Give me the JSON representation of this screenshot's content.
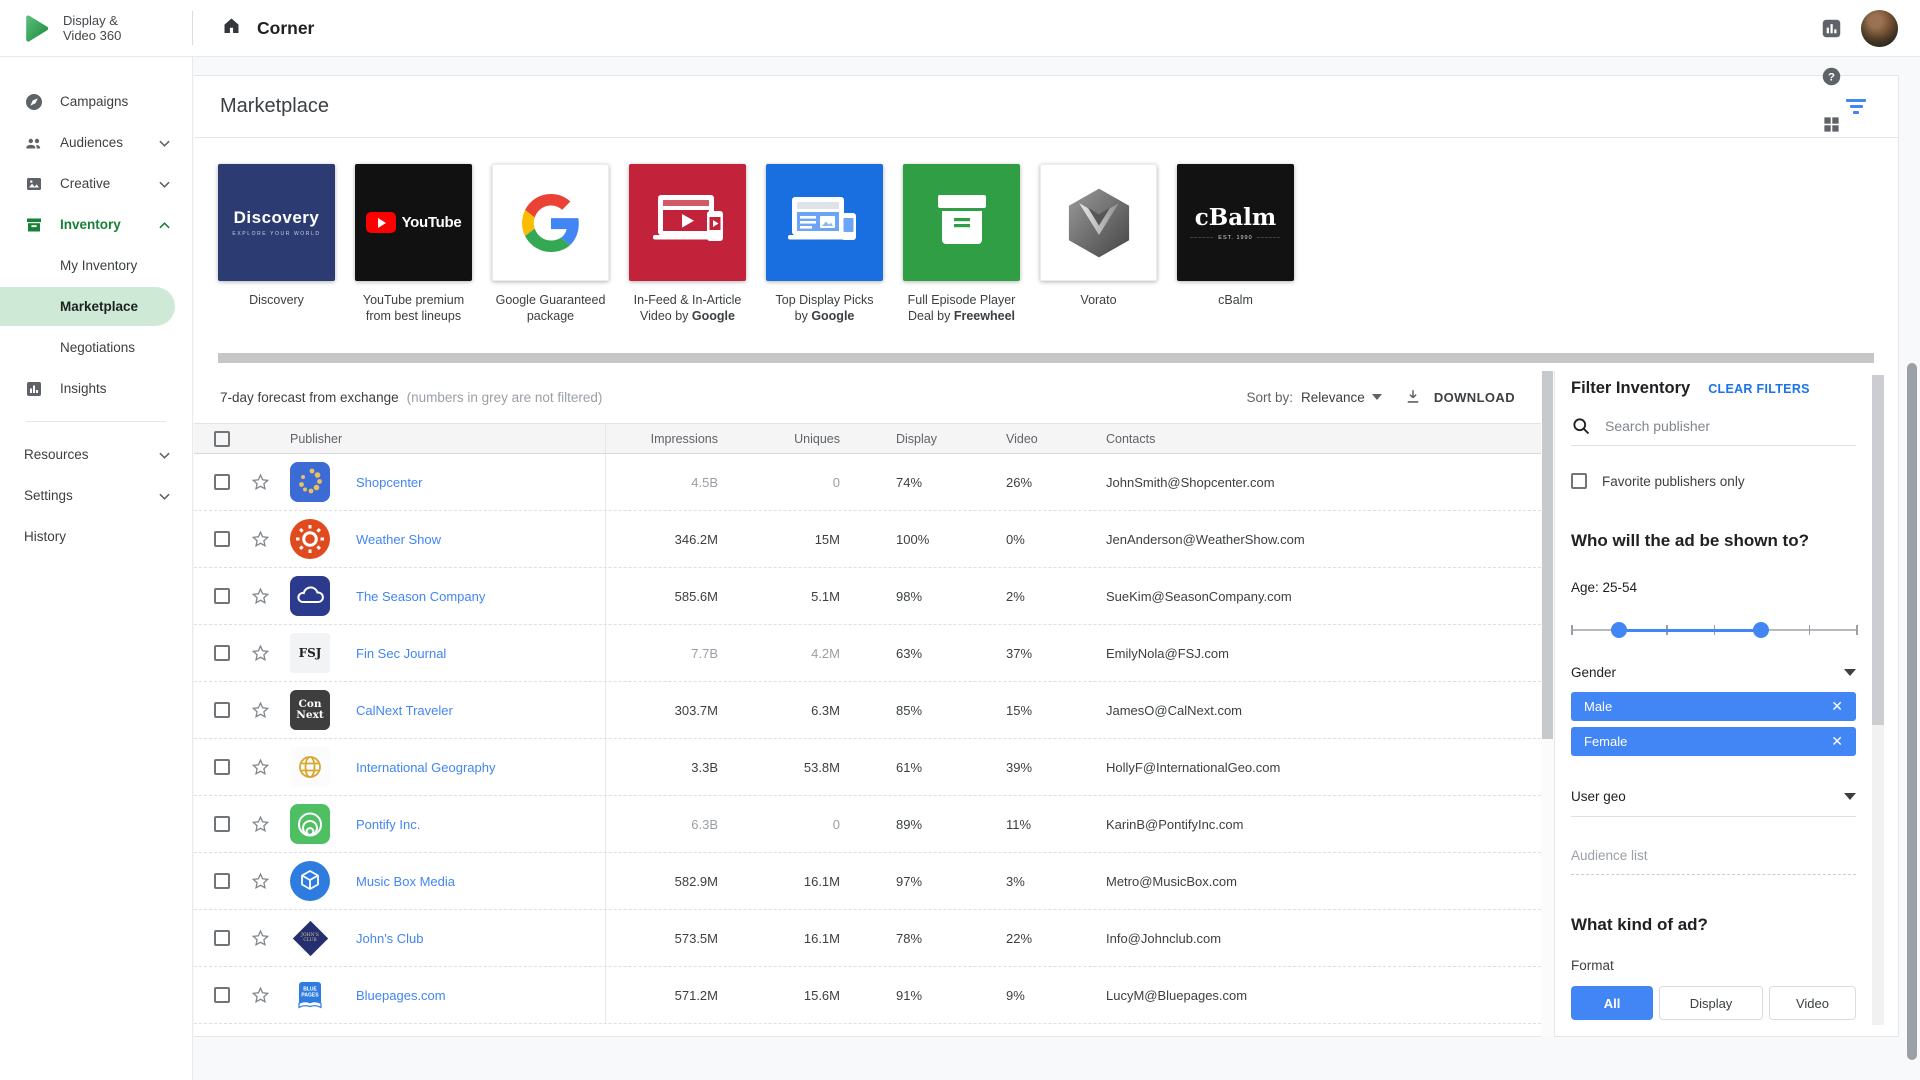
{
  "colors": {
    "accent_blue": "#4285f4",
    "clear_blue": "#1a73e8",
    "inventory_green": "#188038",
    "pill_green": "#ceead6"
  },
  "topbar": {
    "product_name": "Display &\nVideo 360",
    "partner_name": "Corner",
    "icons": [
      "search-icon",
      "more-icon",
      "reports-icon",
      "help-icon",
      "apps-icon"
    ]
  },
  "sidebar": {
    "items": [
      {
        "label": "Campaigns",
        "icon": "compass-icon"
      },
      {
        "label": "Audiences",
        "icon": "people-icon",
        "chevron": "down"
      },
      {
        "label": "Creative",
        "icon": "image-icon",
        "chevron": "down"
      },
      {
        "label": "Inventory",
        "icon": "box-icon",
        "chevron": "up",
        "active": true
      },
      {
        "label": "My Inventory",
        "sub": true
      },
      {
        "label": "Marketplace",
        "sub": true,
        "selected": true
      },
      {
        "label": "Negotiations",
        "sub": true
      },
      {
        "label": "Insights",
        "icon": "insights-icon"
      },
      {
        "divider": true
      },
      {
        "label": "Resources",
        "chevron": "down",
        "plain": true
      },
      {
        "label": "Settings",
        "chevron": "down",
        "plain": true
      },
      {
        "label": "History",
        "plain": true
      }
    ]
  },
  "page": {
    "title": "Marketplace",
    "cards": [
      {
        "line1": "Discovery",
        "line2": "",
        "bold": "",
        "art": "discovery"
      },
      {
        "line1": "YouTube premium",
        "line2": "from best lineups",
        "bold": "",
        "art": "youtube"
      },
      {
        "line1": "Google Guaranteed",
        "line2": "package",
        "bold": "",
        "art": "google"
      },
      {
        "line1": "In-Feed & In-Article",
        "line2": "Video by",
        "bold": "Google",
        "art": "infeed"
      },
      {
        "line1": "Top Display Picks",
        "line2": "by",
        "bold": "Google",
        "art": "topdisplay"
      },
      {
        "line1": "Full Episode Player",
        "line2": "Deal by",
        "bold": "Freewheel",
        "art": "fullepisode"
      },
      {
        "line1": "Vorato",
        "line2": "",
        "bold": "",
        "art": "vorato"
      },
      {
        "line1": "cBalm",
        "line2": "",
        "bold": "",
        "art": "cbalm"
      }
    ],
    "controls": {
      "forecast_label": "7-day forecast from exchange",
      "forecast_note": "(numbers in grey are not filtered)",
      "sort_by_label": "Sort by:",
      "sort_value": "Relevance",
      "download_label": "DOWNLOAD"
    },
    "table": {
      "columns": [
        "Publisher",
        "Impressions",
        "Uniques",
        "Display",
        "Video",
        "Contacts"
      ],
      "rows": [
        {
          "publisher": "Shopcenter",
          "impressions": "4.5B",
          "uniques": "0",
          "display": "74%",
          "video": "26%",
          "contact": "JohnSmith@Shopcenter.com",
          "grey": true,
          "icon": {
            "kind": "dots",
            "bg": "#3d6bd6",
            "fg": "#ecc15d"
          }
        },
        {
          "publisher": "Weather Show",
          "impressions": "346.2M",
          "uniques": "15M",
          "display": "100%",
          "video": "0%",
          "contact": "JenAnderson@WeatherShow.com",
          "grey": false,
          "icon": {
            "kind": "sun",
            "bg": "#e04a1e",
            "fg": "#ffffff"
          }
        },
        {
          "publisher": "The Season Company",
          "impressions": "585.6M",
          "uniques": "5.1M",
          "display": "98%",
          "video": "2%",
          "contact": "SueKim@SeasonCompany.com",
          "grey": false,
          "icon": {
            "kind": "cloud",
            "bg": "#2b3a8c",
            "fg": "#ffffff"
          }
        },
        {
          "publisher": "Fin Sec Journal",
          "impressions": "7.7B",
          "uniques": "4.2M",
          "display": "63%",
          "video": "37%",
          "contact": "EmilyNola@FSJ.com",
          "grey": true,
          "icon": {
            "kind": "fsj",
            "bg": "#f1f3f4",
            "fg": "#202124",
            "text": "FSJ"
          }
        },
        {
          "publisher": "CalNext Traveler",
          "impressions": "303.7M",
          "uniques": "6.3M",
          "display": "85%",
          "video": "15%",
          "contact": "JamesO@CalNext.com",
          "grey": false,
          "icon": {
            "kind": "connext",
            "bg": "#3e3e3e",
            "fg": "#ffffff",
            "text": "Con Next"
          }
        },
        {
          "publisher": "International Geography",
          "impressions": "3.3B",
          "uniques": "53.8M",
          "display": "61%",
          "video": "39%",
          "contact": "HollyF@InternationalGeo.com",
          "grey": false,
          "icon": {
            "kind": "globe",
            "bg": "#fcfcfc",
            "fg": "#d9a62e"
          }
        },
        {
          "publisher": "Pontify Inc.",
          "impressions": "6.3B",
          "uniques": "0",
          "display": "89%",
          "video": "11%",
          "contact": "KarinB@PontifyInc.com",
          "grey": true,
          "icon": {
            "kind": "rings",
            "bg": "#4fbf63",
            "fg": "#ffffff"
          }
        },
        {
          "publisher": "Music Box Media",
          "impressions": "582.9M",
          "uniques": "16.1M",
          "display": "97%",
          "video": "3%",
          "contact": "Metro@MusicBox.com",
          "grey": false,
          "icon": {
            "kind": "cube",
            "bg": "#2e7ce0",
            "fg": "#ffffff"
          }
        },
        {
          "publisher": "John's Club",
          "impressions": "573.5M",
          "uniques": "16.1M",
          "display": "78%",
          "video": "22%",
          "contact": "Info@Johnclub.com",
          "grey": false,
          "icon": {
            "kind": "diamond",
            "bg": "#ffffff",
            "fg": "#252e6e",
            "text": "JOHN'S CLUB"
          }
        },
        {
          "publisher": "Bluepages.com",
          "impressions": "571.2M",
          "uniques": "15.6M",
          "display": "91%",
          "video": "9%",
          "contact": "LucyM@Bluepages.com",
          "grey": false,
          "icon": {
            "kind": "book",
            "bg": "#ffffff",
            "fg": "#2e7ce0",
            "text": "BLUE PAGES"
          }
        }
      ]
    },
    "filter": {
      "title": "Filter Inventory",
      "clear_label": "CLEAR FILTERS",
      "search_placeholder": "Search publisher",
      "favorites_label": "Favorite publishers only",
      "audience_heading": "Who will the ad be shown to?",
      "age_label": "Age: 25-54",
      "slider": {
        "tick_count": 7,
        "handles_pct": [
          16.7,
          66.7
        ]
      },
      "gender_label": "Gender",
      "gender_chips": [
        "Male",
        "Female"
      ],
      "user_geo_label": "User geo",
      "audience_list_label": "Audience list",
      "ad_heading": "What kind of ad?",
      "format_label": "Format",
      "format_options": [
        {
          "label": "All",
          "selected": true
        },
        {
          "label": "Display",
          "selected": false
        },
        {
          "label": "Video",
          "selected": false
        }
      ]
    }
  }
}
